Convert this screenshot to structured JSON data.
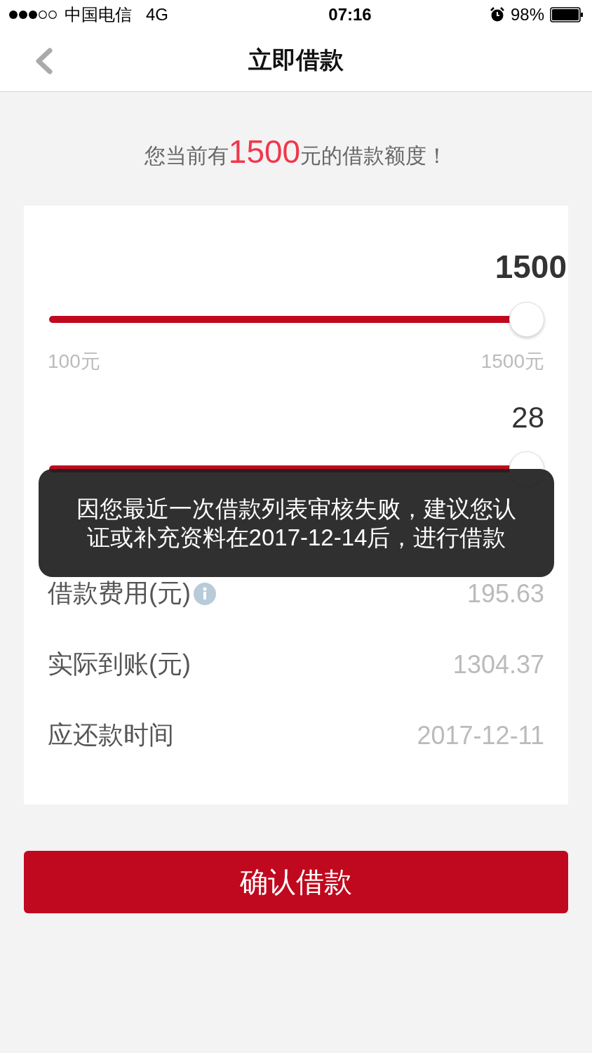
{
  "status_bar": {
    "carrier": "中国电信",
    "network": "4G",
    "time": "07:16",
    "battery": "98%"
  },
  "nav": {
    "title": "立即借款"
  },
  "quota": {
    "prefix": "您当前有",
    "amount": "1500",
    "suffix": "元的借款额度！"
  },
  "sliders": [
    {
      "value": "1500",
      "level": 1,
      "min_label": "100元",
      "max_label": "1500元"
    },
    {
      "value": "28",
      "level": 1
    }
  ],
  "details": [
    {
      "label": "借款费用(元)",
      "value": "195.63",
      "info": true
    },
    {
      "label": "实际到账(元)",
      "value": "1304.37",
      "info": false
    },
    {
      "label": "应还款时间",
      "value": "2017-12-11",
      "info": false
    }
  ],
  "confirm_button": "确认借款",
  "toast": {
    "message": "因您最近一次借款列表审核失败，建议您认证或补充资料在2017-12-14后，进行借款"
  }
}
